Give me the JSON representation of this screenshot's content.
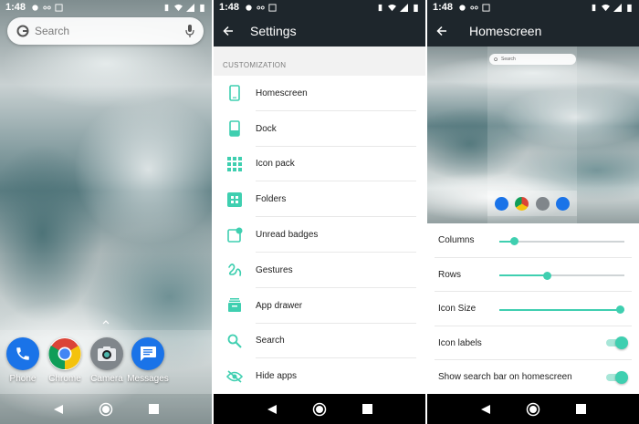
{
  "status": {
    "time": "1:48"
  },
  "home": {
    "search_placeholder": "Search",
    "dock": [
      {
        "label": "Phone",
        "icon": "phone-icon",
        "color": "#1a73e8"
      },
      {
        "label": "Chrome",
        "icon": "chrome-icon",
        "color": "#ffffff"
      },
      {
        "label": "Camera",
        "icon": "camera-icon",
        "color": "#80868b"
      },
      {
        "label": "Messages",
        "icon": "messages-icon",
        "color": "#1a73e8"
      }
    ]
  },
  "settings": {
    "title": "Settings",
    "section": "CUSTOMIZATION",
    "items": [
      {
        "label": "Homescreen",
        "icon": "phone-outline-icon"
      },
      {
        "label": "Dock",
        "icon": "dock-icon"
      },
      {
        "label": "Icon pack",
        "icon": "grid-icon"
      },
      {
        "label": "Folders",
        "icon": "folder-icon"
      },
      {
        "label": "Unread badges",
        "icon": "badge-icon"
      },
      {
        "label": "Gestures",
        "icon": "gesture-icon"
      },
      {
        "label": "App drawer",
        "icon": "app-drawer-icon"
      },
      {
        "label": "Search",
        "icon": "search-icon"
      },
      {
        "label": "Hide apps",
        "icon": "eye-off-icon"
      }
    ],
    "accent": "#3fcfb0"
  },
  "homescreen": {
    "title": "Homescreen",
    "preview_search": "Search",
    "prefs": [
      {
        "label": "Columns",
        "kind": "slider",
        "value": 0.12
      },
      {
        "label": "Rows",
        "kind": "slider",
        "value": 0.38
      },
      {
        "label": "Icon Size",
        "kind": "slider",
        "value": 0.97
      },
      {
        "label": "Icon labels",
        "kind": "toggle",
        "on": true
      },
      {
        "label": "Show search bar on homescreen",
        "kind": "toggle",
        "on": true
      }
    ]
  }
}
